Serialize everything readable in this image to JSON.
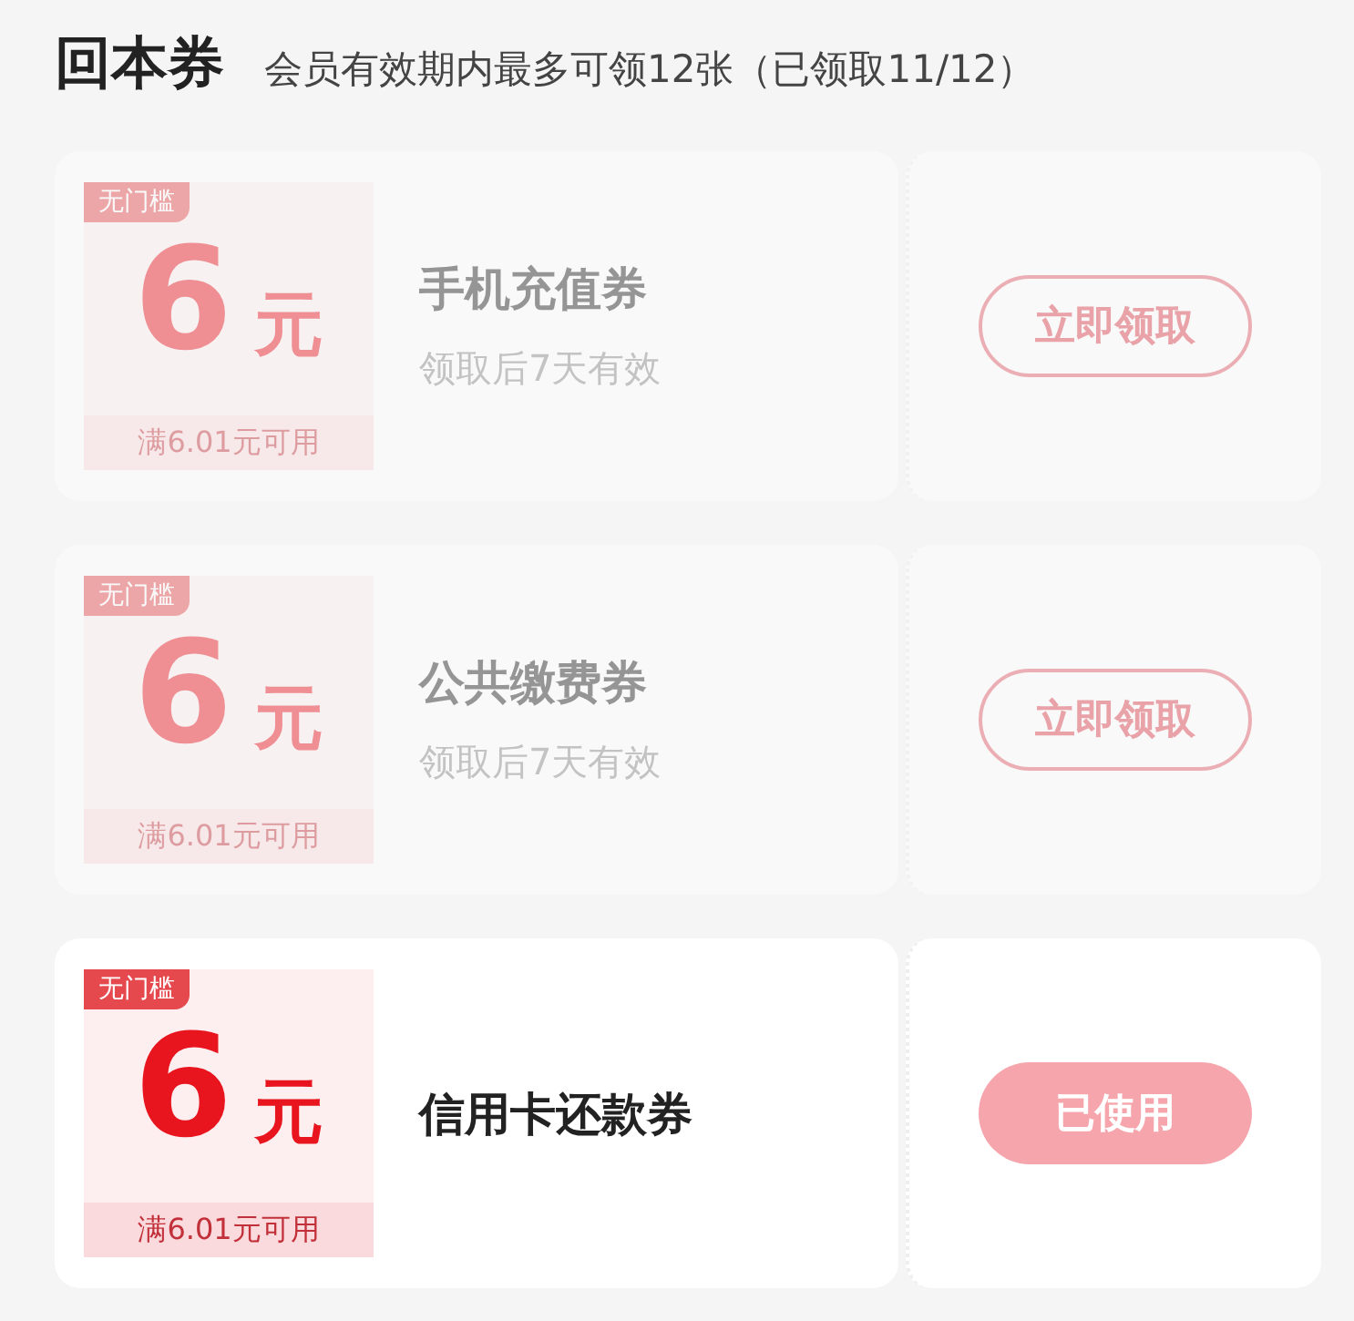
{
  "header": {
    "title": "回本券",
    "subtitle": "会员有效期内最多可领12张（已领取11/12）"
  },
  "coupons": [
    {
      "tag": "无门槛",
      "amount": "6",
      "unit": "元",
      "condition": "满6.01元可用",
      "name": "手机充值券",
      "validity": "领取后7天有效",
      "dimmed": true,
      "button": {
        "kind": "claim",
        "label": "立即领取"
      }
    },
    {
      "tag": "无门槛",
      "amount": "6",
      "unit": "元",
      "condition": "满6.01元可用",
      "name": "公共缴费券",
      "validity": "领取后7天有效",
      "dimmed": true,
      "button": {
        "kind": "claim",
        "label": "立即领取"
      }
    },
    {
      "tag": "无门槛",
      "amount": "6",
      "unit": "元",
      "condition": "满6.01元可用",
      "name": "信用卡还款券",
      "dimmed": false,
      "button": {
        "kind": "used",
        "label": "已使用"
      }
    }
  ]
}
